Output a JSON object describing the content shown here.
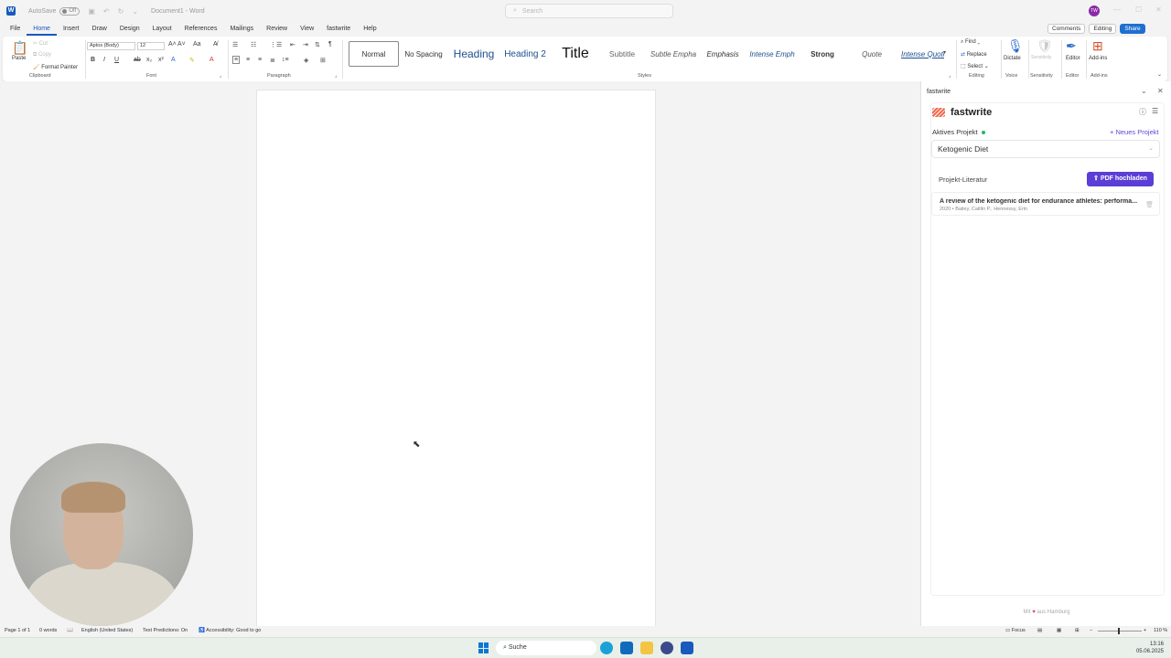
{
  "titlebar": {
    "app_icon": "W",
    "autosave_label": "AutoSave",
    "autosave_state": "Off",
    "doc_title": "Document1 - Word",
    "search_placeholder": "Search",
    "avatar_initials": "TW"
  },
  "menu": {
    "tabs": [
      "File",
      "Home",
      "Insert",
      "Draw",
      "Design",
      "Layout",
      "References",
      "Mailings",
      "Review",
      "View",
      "fastwrite",
      "Help"
    ],
    "active": "Home",
    "comments": "Comments",
    "editing": "Editing",
    "share": "Share"
  },
  "ribbon": {
    "clipboard": {
      "paste": "Paste",
      "cut": "Cut",
      "copy": "Copy",
      "format_painter": "Format Painter",
      "label": "Clipboard"
    },
    "font": {
      "family": "Aptos (Body)",
      "size": "12",
      "label": "Font"
    },
    "paragraph": {
      "label": "Paragraph"
    },
    "styles": {
      "items": [
        "Normal",
        "No Spacing",
        "Heading",
        "Heading 2",
        "Title",
        "Subtitle",
        "Subtle Empha",
        "Emphasis",
        "Intense Emph",
        "Strong",
        "Quote",
        "Intense Quote"
      ],
      "label": "Styles"
    },
    "editing": {
      "find": "Find",
      "replace": "Replace",
      "select": "Select",
      "label": "Editing"
    },
    "voice": {
      "dictate": "Dictate",
      "label": "Voice"
    },
    "sensitivity": {
      "button": "Sensitivity",
      "label": "Sensitivity"
    },
    "editor": {
      "button": "Editor",
      "label": "Editor"
    },
    "addins": {
      "button": "Add-ins",
      "label": "Add-ins"
    }
  },
  "sidepane": {
    "header": "fastwrite",
    "brand": "fastwrite",
    "active_project_label": "Aktives Projekt",
    "new_project": "+ Neues Projekt",
    "selected_project": "Ketogenic Diet",
    "literature_label": "Projekt-Literatur",
    "upload_button": "PDF hochladen",
    "literature": [
      {
        "title": "A review of the ketogenic diet for endurance athletes: performa...",
        "meta": "2020 • Bailey, Caitlin P.; Hennessy, Erin"
      }
    ],
    "footer_prefix": "Mit",
    "footer_suffix": "aus Hamburg"
  },
  "statusbar": {
    "page": "Page 1 of 1",
    "words": "0 words",
    "language": "English (United States)",
    "predictions": "Text Predictions: On",
    "accessibility": "Accessibility: Good to go",
    "focus": "Focus",
    "zoom": "110 %"
  },
  "taskbar": {
    "search": "Suche",
    "time": "13:16",
    "date": "05.06.2025"
  },
  "colors": {
    "word_blue": "#185abd",
    "fastwrite_purple": "#5b3ed6",
    "share_blue": "#1f6fd1",
    "status_green": "#2fb36b"
  }
}
